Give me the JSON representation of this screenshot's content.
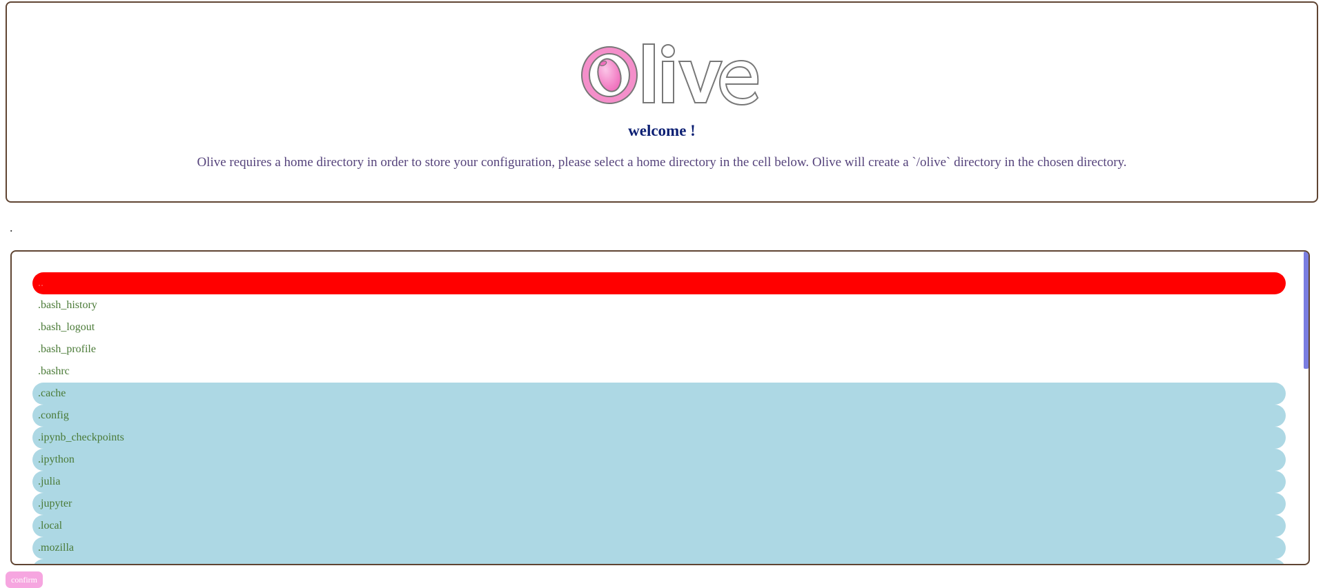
{
  "header": {
    "logo_text": "Olive",
    "welcome": "welcome !",
    "description": "Olive requires a home directory in order to store your configuration, please select a home directory in the cell below. Olive will create a `/olive` directory in the chosen directory."
  },
  "browser": {
    "current_path": ".",
    "entries": [
      {
        "name": "..",
        "kind": "parent"
      },
      {
        "name": ".bash_history",
        "kind": "file"
      },
      {
        "name": ".bash_logout",
        "kind": "file"
      },
      {
        "name": ".bash_profile",
        "kind": "file"
      },
      {
        "name": ".bashrc",
        "kind": "file"
      },
      {
        "name": ".cache",
        "kind": "dir"
      },
      {
        "name": ".config",
        "kind": "dir"
      },
      {
        "name": ".ipynb_checkpoints",
        "kind": "dir"
      },
      {
        "name": ".ipython",
        "kind": "dir"
      },
      {
        "name": ".julia",
        "kind": "dir"
      },
      {
        "name": ".jupyter",
        "kind": "dir"
      },
      {
        "name": ".local",
        "kind": "dir"
      },
      {
        "name": ".mozilla",
        "kind": "dir"
      },
      {
        "name": "",
        "kind": "dir"
      }
    ]
  },
  "actions": {
    "confirm_label": "confirm"
  },
  "colors": {
    "border": "#5f4432",
    "parent_row": "#ff0000",
    "dir_row": "#add8e4",
    "entry_text": "#4a7a37",
    "welcome_text": "#0c1f73",
    "description_text": "#55437b",
    "confirm_button": "#f6a6e0",
    "logo_pink": "#f48fca"
  }
}
